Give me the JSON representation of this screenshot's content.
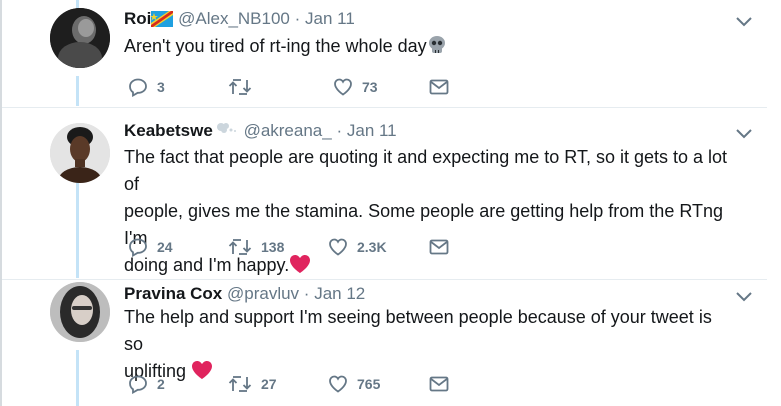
{
  "tweets": [
    {
      "name": "Roi",
      "handle": "@Alex_NB100",
      "separator": "·",
      "date": "Jan 11",
      "text": "Aren't you tired of rt-ing the whole day",
      "replies": "3",
      "retweets": "",
      "likes": "73",
      "name_emoji": "flag-icon",
      "text_emoji": "skull-icon"
    },
    {
      "name": "Keabetswe",
      "handle": "@akreana_",
      "separator": "·",
      "date": "Jan 11",
      "text_lines": [
        "The fact that people are quoting it and expecting me to RT, so it gets to a lot of",
        "people, gives me the stamina. Some people are getting help from the RTng I'm",
        "doing and I'm happy."
      ],
      "replies": "24",
      "retweets": "138",
      "likes": "2.3K",
      "name_emoji": "dash-icon",
      "text_emoji": "heart-icon"
    },
    {
      "name": "Pravina Cox",
      "handle": "@pravluv",
      "separator": "·",
      "date": "Jan 12",
      "text_lines": [
        "The help and support I'm seeing between people because of your tweet is so",
        "uplifting"
      ],
      "replies": "2",
      "retweets": "27",
      "likes": "765",
      "text_emoji": "heart-icon"
    }
  ],
  "colors": {
    "icon_gray": "#657786",
    "thread_line": "#c4e3f7",
    "heart_red": "#e0245e"
  }
}
